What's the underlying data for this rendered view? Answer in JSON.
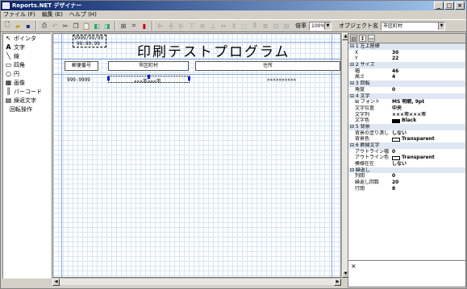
{
  "window": {
    "title": "Reports.NET デザイナー"
  },
  "window_controls": {
    "minimize": "_",
    "maximize": "□",
    "close": "×"
  },
  "menu": [
    "ファイル (F)",
    "編集 (E)",
    "ヘルプ (H)"
  ],
  "toolbar": {
    "zoom_label": "倍率",
    "zoom_value": "100%",
    "object_label": "オブジェクト名",
    "object_value": "市区町村"
  },
  "toolbox": [
    {
      "icon": "pointer-icon",
      "glyph": "↖",
      "label": "ポインタ"
    },
    {
      "icon": "text-icon",
      "glyph": "A",
      "label": "文字"
    },
    {
      "icon": "line-icon",
      "glyph": "╲",
      "label": "線"
    },
    {
      "icon": "rectangle-icon",
      "glyph": "▭",
      "label": "四角"
    },
    {
      "icon": "circle-icon",
      "glyph": "○",
      "label": "円"
    },
    {
      "icon": "image-icon",
      "glyph": "▦",
      "label": "画像"
    },
    {
      "icon": "barcode-icon",
      "glyph": "║",
      "label": "バーコード"
    },
    {
      "icon": "repeat-text-icon",
      "glyph": "▤",
      "label": "繰返文字"
    },
    {
      "icon": "",
      "glyph": "",
      "label": "回転操作"
    }
  ],
  "canvas": {
    "date_field": "9999/99/99",
    "time_field": "99:99:99",
    "report_title": "印刷テストプログラム",
    "headers": [
      "郵便番号",
      "市区町村",
      "住所"
    ],
    "row": {
      "zip": "999-9999",
      "city": "×××市×××市",
      "address": "××××××××××"
    }
  },
  "properties": [
    {
      "type": "cat",
      "key": "⊟ 1 左上座標"
    },
    {
      "key": "X",
      "value": "30"
    },
    {
      "key": "Y",
      "value": "22"
    },
    {
      "type": "cat",
      "key": "⊟ 2 サイズ"
    },
    {
      "key": "幅",
      "value": "46"
    },
    {
      "key": "高さ",
      "value": "4"
    },
    {
      "type": "cat",
      "key": "⊟ 3 回転"
    },
    {
      "key": "角度",
      "value": "0"
    },
    {
      "type": "cat",
      "key": "⊟ 4 文字"
    },
    {
      "key": "⊞ フォント",
      "value": "MS 明朝, 9pt"
    },
    {
      "key": "文字位置",
      "value": "中央"
    },
    {
      "key": "文字列",
      "value": "×××市×××市"
    },
    {
      "key": "文字色",
      "value": "Black",
      "swatch": "#000000"
    },
    {
      "type": "cat",
      "key": "⊟ 5 背景"
    },
    {
      "key": "背景の塗り潰し",
      "value": "しない"
    },
    {
      "key": "背景色",
      "value": "Transparent",
      "swatch": "#ffffff"
    },
    {
      "type": "cat",
      "key": "⊟ 6 飾縁文字"
    },
    {
      "key": "アウトライン幅",
      "value": "0"
    },
    {
      "key": "アウトライン色",
      "value": "Transparent",
      "swatch": "#ffffff"
    },
    {
      "key": "模様在在",
      "value": "しない"
    },
    {
      "type": "cat",
      "key": "⊟ 繰返し"
    },
    {
      "key": "列間",
      "value": "0"
    },
    {
      "key": "繰返し回数",
      "value": "20"
    },
    {
      "key": "行間",
      "value": "8"
    }
  ],
  "description_panel": {
    "close": "×"
  }
}
